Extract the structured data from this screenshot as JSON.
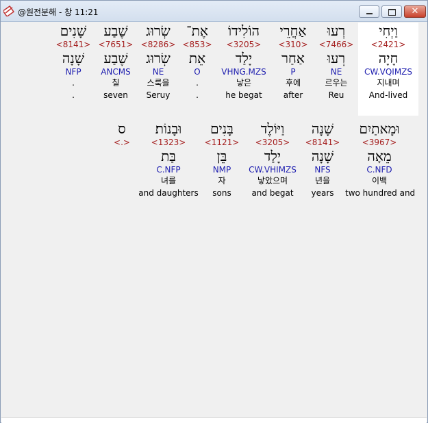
{
  "window": {
    "title": "@원전분해 - 창 11:21",
    "close_glyph": "✕"
  },
  "rows": [
    {
      "words": [
        {
          "heb": "וַיְחִי",
          "num": "<2421>",
          "lemma": "חָיָה",
          "morph": "CW.VQIMZS",
          "kor": "지내며",
          "eng": "And-lived",
          "highlight": true
        },
        {
          "heb": "רְעוּ",
          "num": "<7466>",
          "lemma": "רְעוּ",
          "morph": "NE",
          "kor": "르우는",
          "eng": "Reu"
        },
        {
          "heb": "אַחֲרֵי",
          "num": "<310>",
          "lemma": "אַחַר",
          "morph": "P",
          "kor": "후에",
          "eng": "after"
        },
        {
          "heb": "הוֹלִידוֹ",
          "num": "<3205>",
          "lemma": "יָלַד",
          "morph": "VHNG.MZS",
          "kor": "낳은",
          "eng": "he begat"
        },
        {
          "heb": "אֶת־",
          "num": "<853>",
          "lemma": "אֵת",
          "morph": "O",
          "kor": ".",
          "eng": "."
        },
        {
          "heb": "שְׂרוּג",
          "num": "<8286>",
          "lemma": "שְׂרוּג",
          "morph": "NE",
          "kor": "스룩을",
          "eng": "Seruy"
        },
        {
          "heb": "שֶׁבַע",
          "num": "<7651>",
          "lemma": "שֶׁבַע",
          "morph": "ANCMS",
          "kor": "칠",
          "eng": "seven"
        },
        {
          "heb": "שָׁנִים",
          "num": "<8141>",
          "lemma": "שָׁנָה",
          "morph": "NFP",
          "kor": ".",
          "eng": "."
        }
      ]
    },
    {
      "words": [
        {
          "heb": "וּמָאתַיִם",
          "num": "<3967>",
          "lemma": "מֵאָה",
          "morph": "C.NFD",
          "kor": "이백",
          "eng": "two hundred and"
        },
        {
          "heb": "שָׁנָה",
          "num": "<8141>",
          "lemma": "שָׁנָה",
          "morph": "NFS",
          "kor": "년을",
          "eng": "years"
        },
        {
          "heb": "וַיּוֹלֶד",
          "num": "<3205>",
          "lemma": "יָלַד",
          "morph": "CW.VHIMZS",
          "kor": "낳았으며",
          "eng": "and begat"
        },
        {
          "heb": "בָּנִים",
          "num": "<1121>",
          "lemma": "בֵּן",
          "morph": "NMP",
          "kor": "자",
          "eng": "sons"
        },
        {
          "heb": "וּבָנוֹת׃",
          "num": "<1323>",
          "lemma": "בַּת",
          "morph": "C.NFP",
          "kor": "녀를",
          "eng": "and daughters"
        },
        {
          "heb": "ס",
          "num": "<.>",
          "lemma": "",
          "morph": "",
          "kor": "",
          "eng": ""
        }
      ]
    }
  ]
}
